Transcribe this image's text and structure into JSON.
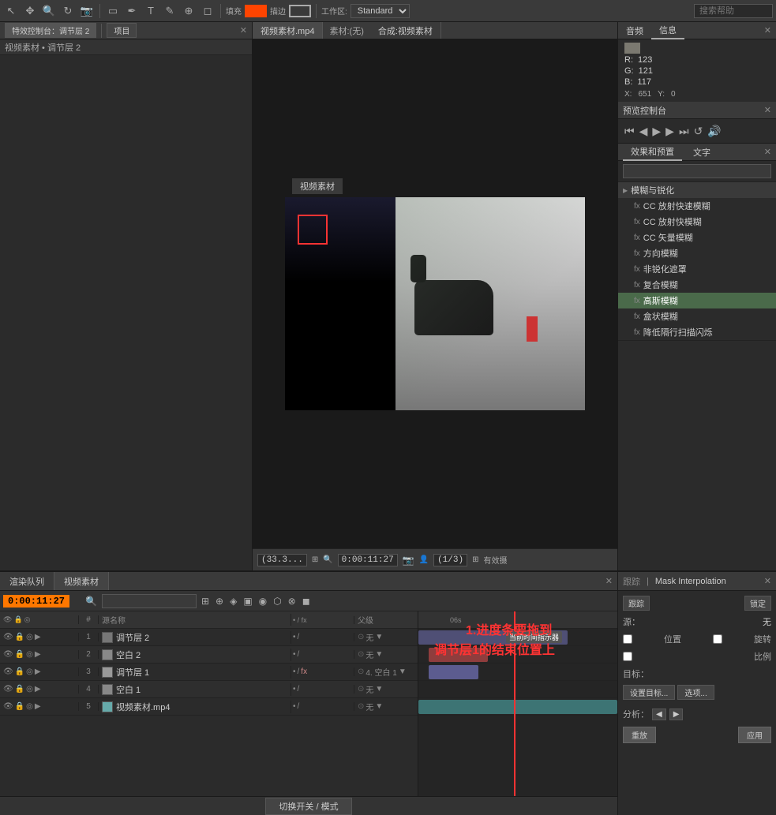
{
  "toolbar": {
    "fill_label": "填充",
    "stroke_label": "描边",
    "workspace_label": "工作区:",
    "workspace_value": "Standard",
    "search_placeholder": "搜索帮助",
    "icons": [
      "arrow",
      "move",
      "zoom",
      "rotate",
      "camera-rotate",
      "mask",
      "pen",
      "text",
      "clone",
      "brush",
      "eraser"
    ]
  },
  "left_panel": {
    "tab_label": "特效控制台：调节层 2",
    "project_label": "项目",
    "breadcrumb": "视频素材 • 调节层 2"
  },
  "preview": {
    "tab1": "视频素材.mp4",
    "tab2": "素材:(无)",
    "tab3": "合成:视频素材",
    "panel_title": "视频素材",
    "timecode": "(33.3...",
    "time_display": "0:00:11:27",
    "quality": "(1/3)",
    "status": "有效摄"
  },
  "right_info": {
    "tab1": "音频",
    "tab2": "信息",
    "r_label": "R:",
    "r_value": "123",
    "g_label": "G:",
    "g_value": "121",
    "b_label": "B:",
    "b_value": "117",
    "x_label": "X:",
    "x_value": "651",
    "y_label": "Y:",
    "y_value": "0"
  },
  "preview_control": {
    "title": "预览控制台"
  },
  "effects_panel": {
    "tab1": "效果和预置",
    "tab2": "文字",
    "search_placeholder": "",
    "group_title": "模糊与锐化",
    "items": [
      {
        "name": "CC 放射快速模糊",
        "icon": "fx"
      },
      {
        "name": "CC 放射快模糊",
        "icon": "fx"
      },
      {
        "name": "CC 矢量模糊",
        "icon": "fx"
      },
      {
        "name": "方向模糊",
        "icon": "fx"
      },
      {
        "name": "非锐化遮罩",
        "icon": "fx"
      },
      {
        "name": "复合模糊",
        "icon": "fx"
      },
      {
        "name": "高斯模糊",
        "icon": "fx",
        "highlighted": true
      },
      {
        "name": "盒状模糊",
        "icon": "fx"
      },
      {
        "name": "降低隔行扫描闪烁",
        "icon": "fx"
      }
    ]
  },
  "timeline": {
    "tab1": "渲染队列",
    "tab2": "视频素材",
    "timecode": "0:00:11:27",
    "columns": {
      "name": "源名称",
      "parent": "父级"
    },
    "layers": [
      {
        "num": "1",
        "name": "调节层 2",
        "color": "#777",
        "switches": "•/ fx",
        "parent": "无"
      },
      {
        "num": "2",
        "name": "空白 2",
        "color": "#888",
        "switches": "•/",
        "parent": "无"
      },
      {
        "num": "3",
        "name": "调节层 1",
        "color": "#999",
        "switches": "•/ fx",
        "parent": "4. 空白 1"
      },
      {
        "num": "4",
        "name": "空白 1",
        "color": "#888",
        "switches": "•/",
        "parent": "无"
      },
      {
        "num": "5",
        "name": "视频素材.mp4",
        "color": "#66aaaa",
        "switches": "•/",
        "parent": "无"
      }
    ],
    "annotations": {
      "line1": "1.进度条要拖到",
      "line2": "调节层1的结束位置上"
    },
    "tooltip": "当前时间指示器"
  },
  "mask_interp": {
    "title": "Mask Interpolation",
    "tab1": "跟踪",
    "tab2": "Mask Interpolation",
    "btn_track": "跟踪",
    "btn_fix": "锁定",
    "source_label": "源：",
    "source_value": "无",
    "checkbox_position": "位置",
    "checkbox_rotate": "旋转",
    "checkbox_scale": "比例",
    "target_label": "目标：",
    "target_btn": "设置目标...",
    "options_btn": "选项...",
    "analyze_label": "分析：",
    "replay_label": "重放",
    "apply_label": "应用"
  },
  "footer": {
    "btn_label": "切换开关 / 模式"
  }
}
